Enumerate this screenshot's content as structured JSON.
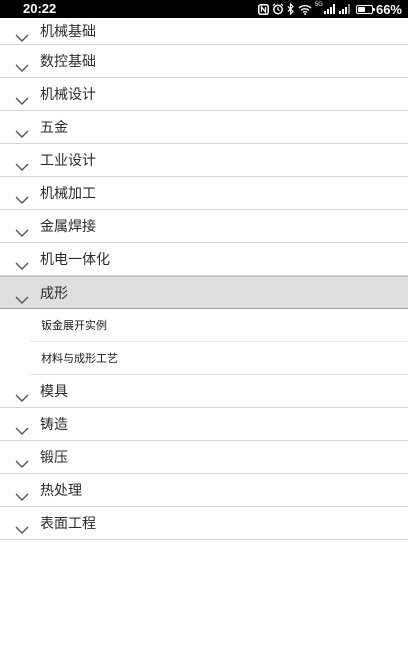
{
  "status_bar": {
    "time": "20:22",
    "network_label": "5G",
    "battery_percent_text": "66%",
    "battery_level": 0.66,
    "icons": [
      "nfc-icon",
      "alarm-icon",
      "bluetooth-icon",
      "wifi-icon",
      "signal-icon",
      "signal-icon",
      "battery-icon"
    ]
  },
  "menu": {
    "items": [
      {
        "label": "机械基础"
      },
      {
        "label": "数控基础"
      },
      {
        "label": "机械设计"
      },
      {
        "label": "五金"
      },
      {
        "label": "工业设计"
      },
      {
        "label": "机械加工"
      },
      {
        "label": "金属焊接"
      },
      {
        "label": "机电一体化"
      },
      {
        "label": "成形",
        "expanded": true,
        "children": [
          {
            "label": "钣金展开实例"
          },
          {
            "label": "材料与成形工艺"
          }
        ]
      },
      {
        "label": "模具"
      },
      {
        "label": "铸造"
      },
      {
        "label": "锻压"
      },
      {
        "label": "热处理"
      },
      {
        "label": "表面工程"
      }
    ]
  },
  "colors": {
    "expanded_background": "#dedede",
    "divider": "#d6d6d6",
    "text": "#2b2b2b",
    "chevron": "#555555"
  }
}
